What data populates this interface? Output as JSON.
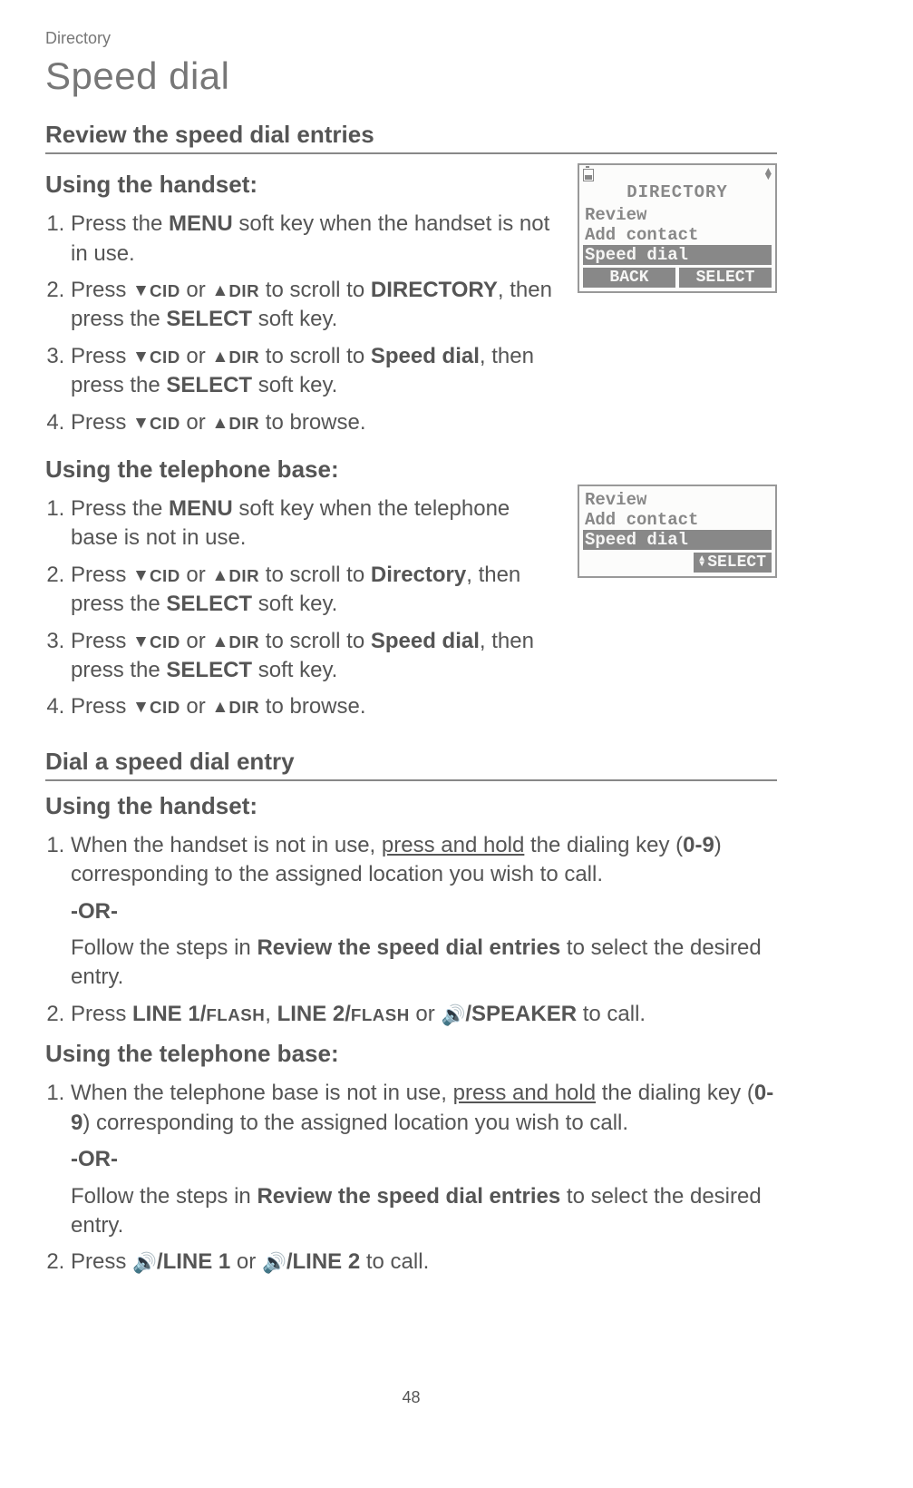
{
  "breadcrumb": "Directory",
  "title": "Speed dial",
  "section1": {
    "heading": "Review the speed dial entries",
    "handset_heading": "Using the handset:",
    "base_heading": "Using the telephone base:",
    "h_step1_a": "Press the ",
    "h_step1_b": "MENU",
    "h_step1_c": " soft key when the handset is not in use.",
    "h_step2_a": "Press ",
    "h_step2_cid": "CID",
    "h_step2_or": " or ",
    "h_step2_dir": "DIR",
    "h_step2_b": " to scroll to ",
    "h_step2_target": "DIRECTORY",
    "h_step2_c": ", then press the ",
    "h_step2_select": "SELECT",
    "h_step2_d": " soft key.",
    "h_step3_target": "Speed dial",
    "h_step4_end": " to browse.",
    "b_step1_a": "Press the ",
    "b_step1_b": "MENU",
    "b_step1_c": " soft key when the telephone base is not in use.",
    "b_step2_target": "Directory"
  },
  "section2": {
    "heading": "Dial a speed dial entry",
    "h_heading": "Using the handset:",
    "b_heading": "Using the telephone base:",
    "h1_a": "When the handset is not in use, ",
    "h1_hold": "press and hold",
    "h1_b": " the dialing key (",
    "h1_keys": "0-9",
    "h1_c": ") corresponding to the assigned location you wish to call.",
    "or": "-OR-",
    "follow_a": "Follow the steps in ",
    "follow_b": "Review the speed dial entries",
    "follow_c": " to select the desired entry.",
    "h2_a": "Press ",
    "h2_l1": "LINE 1/",
    "h2_flash": "FLASH",
    "h2_l2": "LINE 2/",
    "h2_sep1": ", ",
    "h2_sep2": " or ",
    "h2_speaker": "/SPEAKER",
    "h2_end": " to call.",
    "b1_a": "When the telephone base is not in use, ",
    "b2_l1": "/LINE 1",
    "b2_l2": "/LINE 2",
    "b2_or": " or "
  },
  "lcd1": {
    "title": "DIRECTORY",
    "l1": "Review",
    "l2": "Add contact",
    "l3": "Speed dial",
    "back": "BACK",
    "select": "SELECT"
  },
  "lcd2": {
    "l1": "Review",
    "l2": "Add contact",
    "l3": "Speed dial",
    "select": "SELECT"
  },
  "page_number": "48",
  "speaker_glyph": "🔊"
}
